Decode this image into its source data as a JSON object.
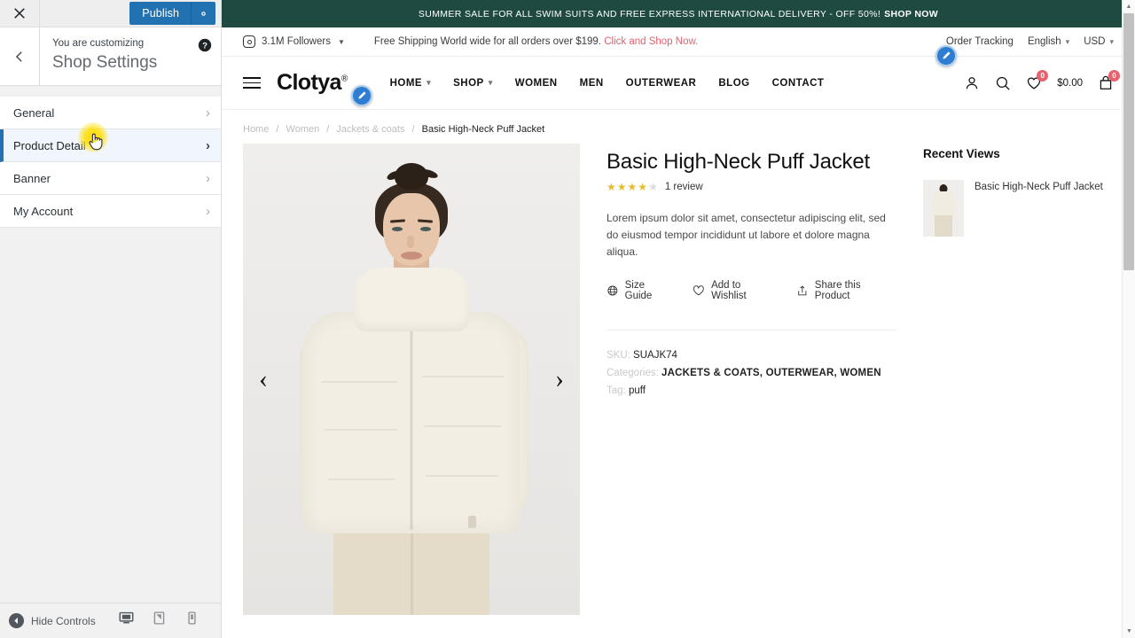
{
  "customizer": {
    "close_label": "Close",
    "publish_label": "Publish",
    "gear_label": "Publish settings",
    "back_label": "Back",
    "subtitle": "You are customizing",
    "title": "Shop Settings",
    "help_label": "Help",
    "items": [
      {
        "label": "General"
      },
      {
        "label": "Product Detail"
      },
      {
        "label": "Banner"
      },
      {
        "label": "My Account"
      }
    ],
    "active_index": 1,
    "footer": {
      "hide_controls": "Hide Controls",
      "devices": [
        {
          "name": "desktop",
          "active": true
        },
        {
          "name": "tablet",
          "active": false
        },
        {
          "name": "mobile",
          "active": false
        }
      ]
    },
    "accent_color": "#2271b1",
    "active_bg": "#f0f6fc"
  },
  "site": {
    "announcement": {
      "text": "SUMMER SALE FOR ALL SWIM SUITS AND FREE EXPRESS INTERNATIONAL DELIVERY - OFF 50%!",
      "cta": "SHOP NOW",
      "bg": "#1f4a42"
    },
    "utilitybar": {
      "followers": "3.1M Followers",
      "shipping_text": "Free Shipping World wide for all orders over $199.",
      "shipping_link": "Click and Shop Now.",
      "order_tracking": "Order Tracking",
      "language": "English",
      "currency": "USD",
      "link_color": "#e0616f"
    },
    "header": {
      "brand": "Clotya",
      "brand_mark": "®",
      "nav": [
        {
          "label": "HOME",
          "has_dropdown": true
        },
        {
          "label": "SHOP",
          "has_dropdown": true
        },
        {
          "label": "WOMEN",
          "has_dropdown": false
        },
        {
          "label": "MEN",
          "has_dropdown": false
        },
        {
          "label": "OUTERWEAR",
          "has_dropdown": false
        },
        {
          "label": "BLOG",
          "has_dropdown": false
        },
        {
          "label": "CONTACT",
          "has_dropdown": false
        }
      ],
      "wishlist_count": "0",
      "cart_count": "0",
      "cart_total": "$0.00"
    },
    "breadcrumb": {
      "items": [
        "Home",
        "Women",
        "Jackets & coats"
      ],
      "current": "Basic High-Neck Puff Jacket"
    },
    "product": {
      "title": "Basic High-Neck Puff Jacket",
      "stars_filled": 4,
      "stars_total": 5,
      "reviews": "1 review",
      "description": "Lorem ipsum dolor sit amet, consectetur adipiscing elit, sed do eiusmod tempor incididunt ut labore et dolore magna aliqua.",
      "actions": [
        {
          "label": "Size Guide",
          "icon": "globe-icon"
        },
        {
          "label": "Add to Wishlist",
          "icon": "heart-icon"
        },
        {
          "label": "Share this Product",
          "icon": "share-icon"
        }
      ],
      "sku_label": "SKU:",
      "sku_value": "SUAJK74",
      "categories_label": "Categories:",
      "categories_value": "JACKETS & COATS, OUTERWEAR, WOMEN",
      "tag_label": "Tag:",
      "tag_value": "puff",
      "prev_label": "Previous image",
      "next_label": "Next image",
      "prev_glyph": "‹",
      "next_glyph": "›"
    },
    "recent_views": {
      "title": "Recent Views",
      "items": [
        {
          "name": "Basic High-Neck Puff Jacket"
        }
      ]
    }
  }
}
